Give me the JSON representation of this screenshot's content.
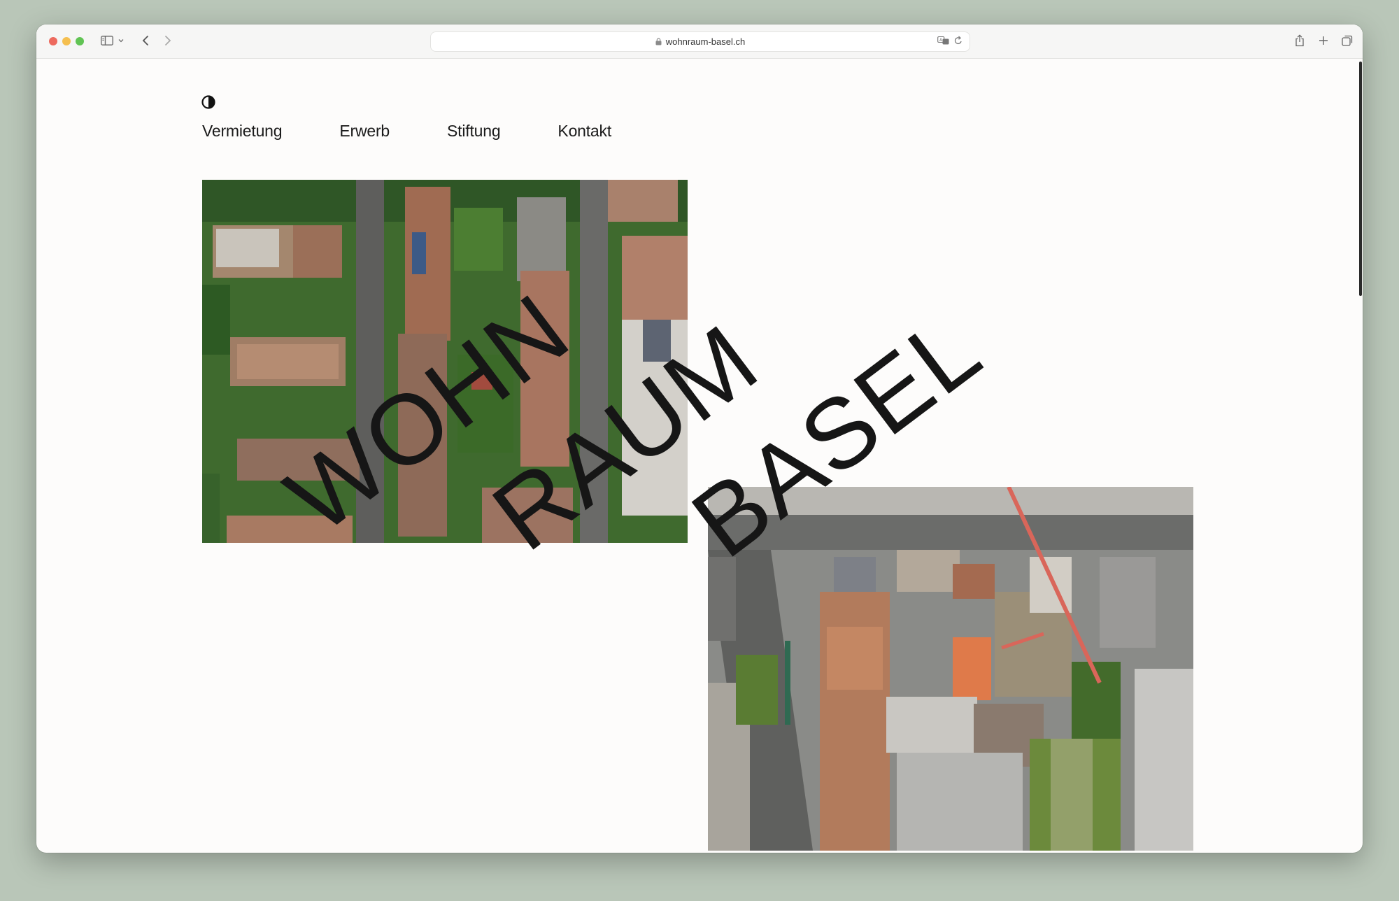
{
  "browser": {
    "url": "wohnraum-basel.ch"
  },
  "nav": {
    "items": [
      {
        "label": "Vermietung"
      },
      {
        "label": "Erwerb"
      },
      {
        "label": "Stiftung"
      },
      {
        "label": "Kontakt"
      }
    ]
  },
  "logo": {
    "line1": "WOHN",
    "line2": "RAUM",
    "line3": "BASEL"
  },
  "icons": {
    "theme_toggle": "half-circle-contrast-icon",
    "sidebar": "sidebar-icon",
    "back": "chevron-left-icon",
    "forward": "chevron-right-icon",
    "share": "share-icon",
    "new_tab": "plus-icon",
    "tabs_overview": "tabs-icon",
    "lock": "lock-icon",
    "translate": "translate-icon",
    "reload": "reload-icon"
  },
  "colors": {
    "page_background": "#fdfcfb",
    "text": "#161616",
    "desktop": "#b9c6b8"
  }
}
